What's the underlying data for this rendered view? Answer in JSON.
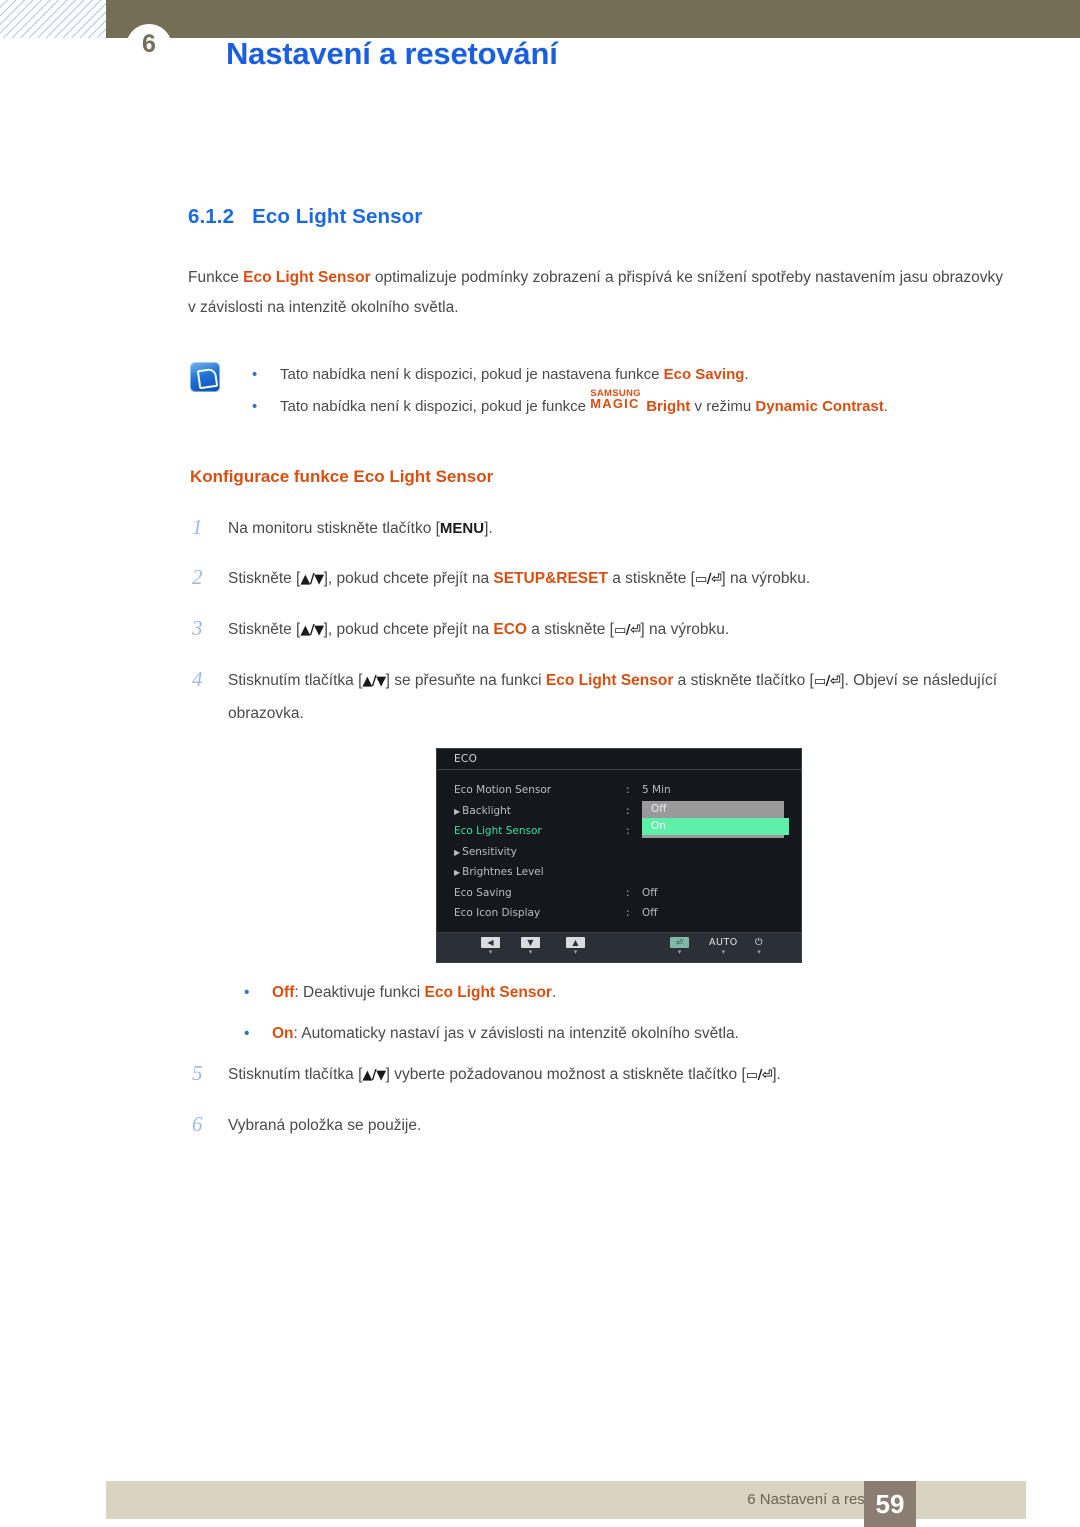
{
  "header": {
    "chapter_badge": "6",
    "title": "Nastavení a resetování"
  },
  "section": {
    "number": "6.1.2",
    "title": "Eco Light Sensor",
    "intro_part1": "Funkce ",
    "intro_highlight": "Eco Light Sensor",
    "intro_part2": " optimalizuje podmínky zobrazení a přispívá ke snížení spotřeby nastavením jasu obrazovky v závislosti na intenzitě okolního světla."
  },
  "note": {
    "icon": "note-pen-icon",
    "items": [
      {
        "pre": "Tato nabídka není k dispozici, pokud je nastavena funkce ",
        "highlight": "Eco Saving",
        "post": "."
      },
      {
        "pre": "Tato nabídka není k dispozici, pokud je funkce ",
        "magic_top": "SAMSUNG",
        "magic_bottom": "MAGIC",
        "magic_suffix": "Bright",
        "mid": " v režimu ",
        "highlight": "Dynamic Contrast",
        "post": "."
      }
    ]
  },
  "procedure": {
    "title": "Konfigurace funkce Eco Light Sensor",
    "steps": [
      {
        "num": "1",
        "pre": "Na monitoru stiskněte tlačítko [",
        "key1": "MENU",
        "post": "]."
      },
      {
        "num": "2",
        "pre": "Stiskněte [",
        "key1": "▲/▼",
        "mid1": "], pokud chcete přejít na ",
        "highlight": "SETUP&RESET",
        "mid2": " a stiskněte [",
        "key2": "▭/⏎",
        "post": "] na výrobku."
      },
      {
        "num": "3",
        "pre": "Stiskněte [",
        "key1": "▲/▼",
        "mid1": "], pokud chcete přejít na ",
        "highlight": "ECO",
        "mid2": " a stiskněte [",
        "key2": "▭/⏎",
        "post": "] na výrobku."
      },
      {
        "num": "4",
        "pre": "Stisknutím tlačítka [",
        "key1": "▲/▼",
        "mid1": "] se přesuňte na funkci ",
        "highlight": "Eco Light Sensor",
        "mid2": " a stiskněte tlačítko [",
        "key2": "▭/⏎",
        "post": "]. Objeví se následující obrazovka."
      },
      {
        "num": "5",
        "pre": "Stisknutím tlačítka [",
        "key1": "▲/▼",
        "mid1": "] vyberte požadovanou možnost a stiskněte tlačítko [",
        "key2": "▭/⏎",
        "post": "]."
      },
      {
        "num": "6",
        "pre": "Vybraná položka se použije."
      }
    ]
  },
  "osd": {
    "title": "ECO",
    "rows": [
      {
        "arrow": "",
        "label": "Eco Motion Sensor",
        "colon": ":",
        "value": "5 Min",
        "selected": false
      },
      {
        "arrow": "▶",
        "label": "Backlight",
        "colon": ":",
        "value": "Off",
        "selected": false
      },
      {
        "arrow": "",
        "label": "Eco Light Sensor",
        "colon": ":",
        "value": "",
        "selected": true
      },
      {
        "arrow": "▶",
        "label": "Sensitivity",
        "colon": "",
        "value": "",
        "selected": false
      },
      {
        "arrow": "▶",
        "label": "Brightnes Level",
        "colon": "",
        "value": "",
        "selected": false
      },
      {
        "arrow": "",
        "label": "Eco Saving",
        "colon": ":",
        "value": "Off",
        "selected": false
      },
      {
        "arrow": "",
        "label": "Eco Icon Display",
        "colon": ":",
        "value": "Off",
        "selected": false
      }
    ],
    "dropdown": {
      "options": [
        {
          "label": "Off",
          "state": "unselected"
        },
        {
          "label": "On",
          "state": "selected"
        }
      ]
    },
    "buttons": [
      {
        "glyph": "◀",
        "kind": "box",
        "tick": "▾"
      },
      {
        "glyph": "▼",
        "kind": "box",
        "tick": "▾"
      },
      {
        "glyph": "▲",
        "kind": "box",
        "tick": "▾"
      },
      {
        "glyph": "⏎",
        "kind": "enter",
        "tick": "▾"
      },
      {
        "glyph": "AUTO",
        "kind": "plain",
        "tick": "▾"
      },
      {
        "glyph": "⏻",
        "kind": "plain",
        "tick": "▾"
      }
    ],
    "colors": {
      "background": "#14171c",
      "selected_label": "#3fe09a",
      "option_selected": "#5df0a8",
      "option_unselected": "#9a9a9a"
    }
  },
  "option_bullets": [
    {
      "name": "Off",
      "pre": "",
      "text": ": Deaktivuje funkci ",
      "highlight": "Eco Light Sensor",
      "post": "."
    },
    {
      "name": "On",
      "pre": "",
      "text": ": Automaticky nastaví jas v závislosti na intenzitě okolního světla.",
      "highlight": "",
      "post": ""
    }
  ],
  "footer": {
    "text": "6 Nastavení a resetování",
    "page": "59"
  },
  "colors": {
    "header_bar": "#736e55",
    "heading_blue": "#1b6ae5",
    "accent_orange": "#d94f12",
    "footer_bar": "#d9d3c2",
    "page_badge": "#8c7d72"
  }
}
